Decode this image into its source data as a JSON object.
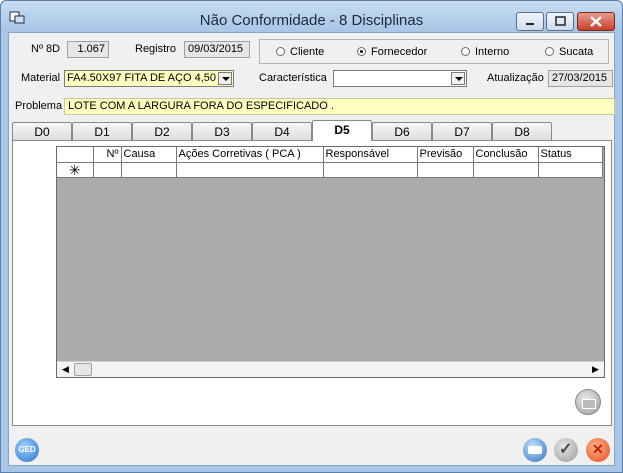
{
  "window": {
    "title": "Não Conformidade - 8 Disciplinas"
  },
  "header": {
    "n8d_label": "Nº 8D",
    "n8d_value": "1.067",
    "registro_label": "Registro",
    "registro_value": "09/03/2015",
    "material_label": "Material",
    "material_value": "FA4.50X97  FITA DE AÇO 4,50",
    "caracteristica_label": "Característica",
    "caracteristica_value": "",
    "atualizacao_label": "Atualização",
    "atualizacao_value": "27/03/2015",
    "problema_label": "Problema",
    "problema_value": "LOTE COM A LARGURA FORA DO ESPECIFICADO  ."
  },
  "origin_options": [
    {
      "label": "Cliente",
      "selected": false
    },
    {
      "label": "Fornecedor",
      "selected": true
    },
    {
      "label": "Interno",
      "selected": false
    },
    {
      "label": "Sucata",
      "selected": false
    }
  ],
  "tabs": [
    "D0",
    "D1",
    "D2",
    "D3",
    "D4",
    "D5",
    "D6",
    "D7",
    "D8"
  ],
  "active_tab": "D5",
  "grid": {
    "columns": [
      "Nº",
      "Causa",
      "Ações Corretivas ( PCA )",
      "Responsável",
      "Previsão",
      "Conclusão",
      "Status"
    ],
    "new_row_marker": "✳"
  },
  "buttons": {
    "ged_label": "GED"
  },
  "colors": {
    "yellow_field": "#ffffc0",
    "window_frame": "#a9c6e6",
    "cancel_red": "#e0501e"
  }
}
